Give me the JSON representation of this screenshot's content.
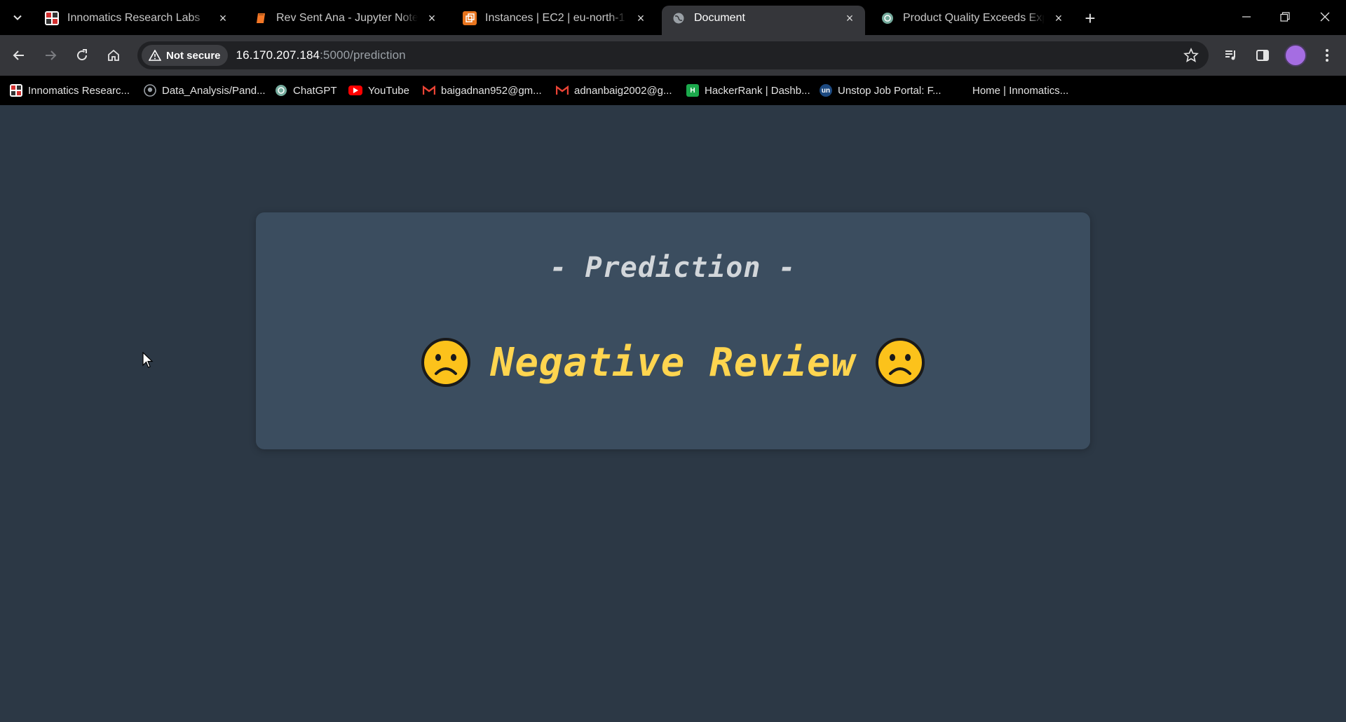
{
  "browser": {
    "tabs": [
      {
        "title": "Innomatics Research Labs",
        "active": false,
        "favicon": "innomatics-logo",
        "color": "#d32f2f"
      },
      {
        "title": "Rev Sent Ana - Jupyter Notebook",
        "active": false,
        "favicon": "jupyter-notebook-icon",
        "color": "#f37726"
      },
      {
        "title": "Instances | EC2 | eu-north-1",
        "active": false,
        "favicon": "aws-ec2-icon",
        "color": "#e8741d"
      },
      {
        "title": "Document",
        "active": true,
        "favicon": "globe-icon",
        "color": "#9aa0a6"
      },
      {
        "title": "Product Quality Exceeds Expectations",
        "active": false,
        "favicon": "chatgpt-icon",
        "color": "#74aa9c"
      }
    ],
    "address": {
      "security_label": "Not secure",
      "host": "16.170.207.184",
      "rest": ":5000/prediction"
    },
    "bookmarks": [
      {
        "label": "Innomatics Researc...",
        "icon": "innomatics-logo",
        "color": "#d32f2f"
      },
      {
        "label": "Data_Analysis/Pand...",
        "icon": "github-icon",
        "color": "#9aa0a6"
      },
      {
        "label": "ChatGPT",
        "icon": "chatgpt-icon",
        "color": "#74aa9c"
      },
      {
        "label": "YouTube",
        "icon": "youtube-icon",
        "color": "#ff0000"
      },
      {
        "label": "baigadnan952@gm...",
        "icon": "gmail-icon",
        "color": "#ea4335"
      },
      {
        "label": "adnanbaig2002@g...",
        "icon": "gmail-icon",
        "color": "#ea4335"
      },
      {
        "label": "HackerRank | Dashb...",
        "icon": "hackerrank-icon",
        "color": "#1ba94c"
      },
      {
        "label": "Unstop Job Portal: F...",
        "icon": "unstop-icon",
        "color": "#1c4980"
      },
      {
        "label": "Home | Innomatics...",
        "icon": "none",
        "color": ""
      }
    ]
  },
  "page": {
    "heading": "- Prediction -",
    "result_label": "Negative Review",
    "result_emoji": "frowning-face-emoji",
    "colors": {
      "background": "#2c3845",
      "card": "#3b4d5f",
      "heading": "#d2d6da",
      "result": "#ffd54f"
    }
  }
}
